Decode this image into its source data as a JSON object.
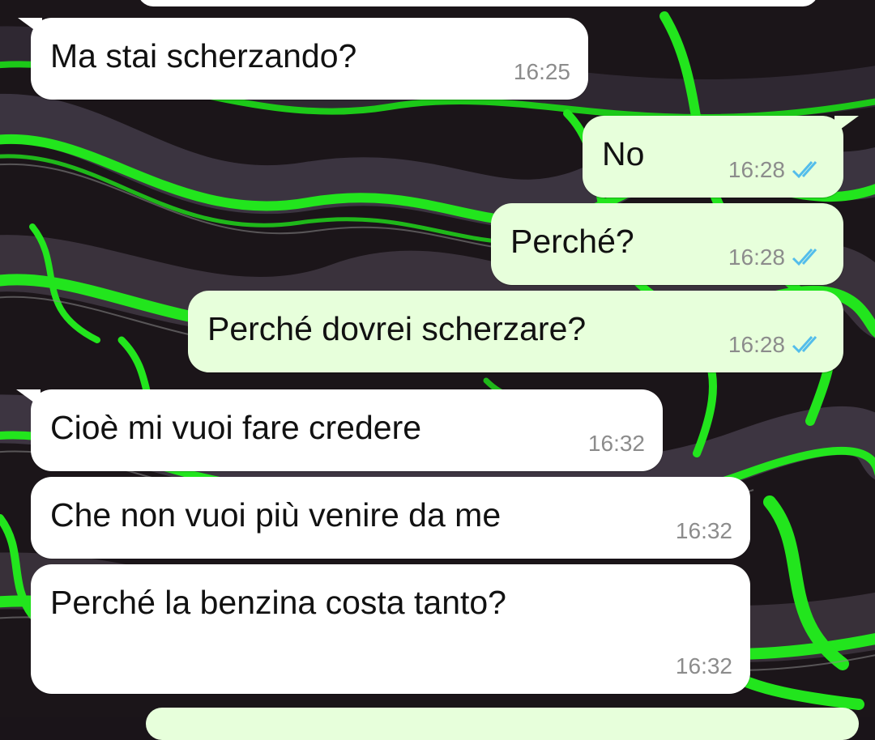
{
  "colors": {
    "incoming_bubble": "#ffffff",
    "outgoing_bubble": "#e7ffdb",
    "read_receipt": "#53bdeb",
    "time_text": "#8c8c8c",
    "wallpaper_green": "#22e51d",
    "wallpaper_dark": "#1a1419"
  },
  "messages": [
    {
      "direction": "in",
      "text": "Ma stai scherzando?",
      "time": "16:25"
    },
    {
      "direction": "out",
      "text": "No",
      "time": "16:28",
      "status": "read",
      "status_icon": "double-check-icon"
    },
    {
      "direction": "out",
      "text": "Perché?",
      "time": "16:28",
      "status": "read",
      "status_icon": "double-check-icon"
    },
    {
      "direction": "out",
      "text": "Perché dovrei scherzare?",
      "time": "16:28",
      "status": "read",
      "status_icon": "double-check-icon"
    },
    {
      "direction": "in",
      "text": "Cioè mi vuoi fare credere",
      "time": "16:32"
    },
    {
      "direction": "in",
      "text": "Che non vuoi più venire da me",
      "time": "16:32"
    },
    {
      "direction": "in",
      "text": "Perché la benzina costa tanto?",
      "time": "16:32"
    }
  ]
}
